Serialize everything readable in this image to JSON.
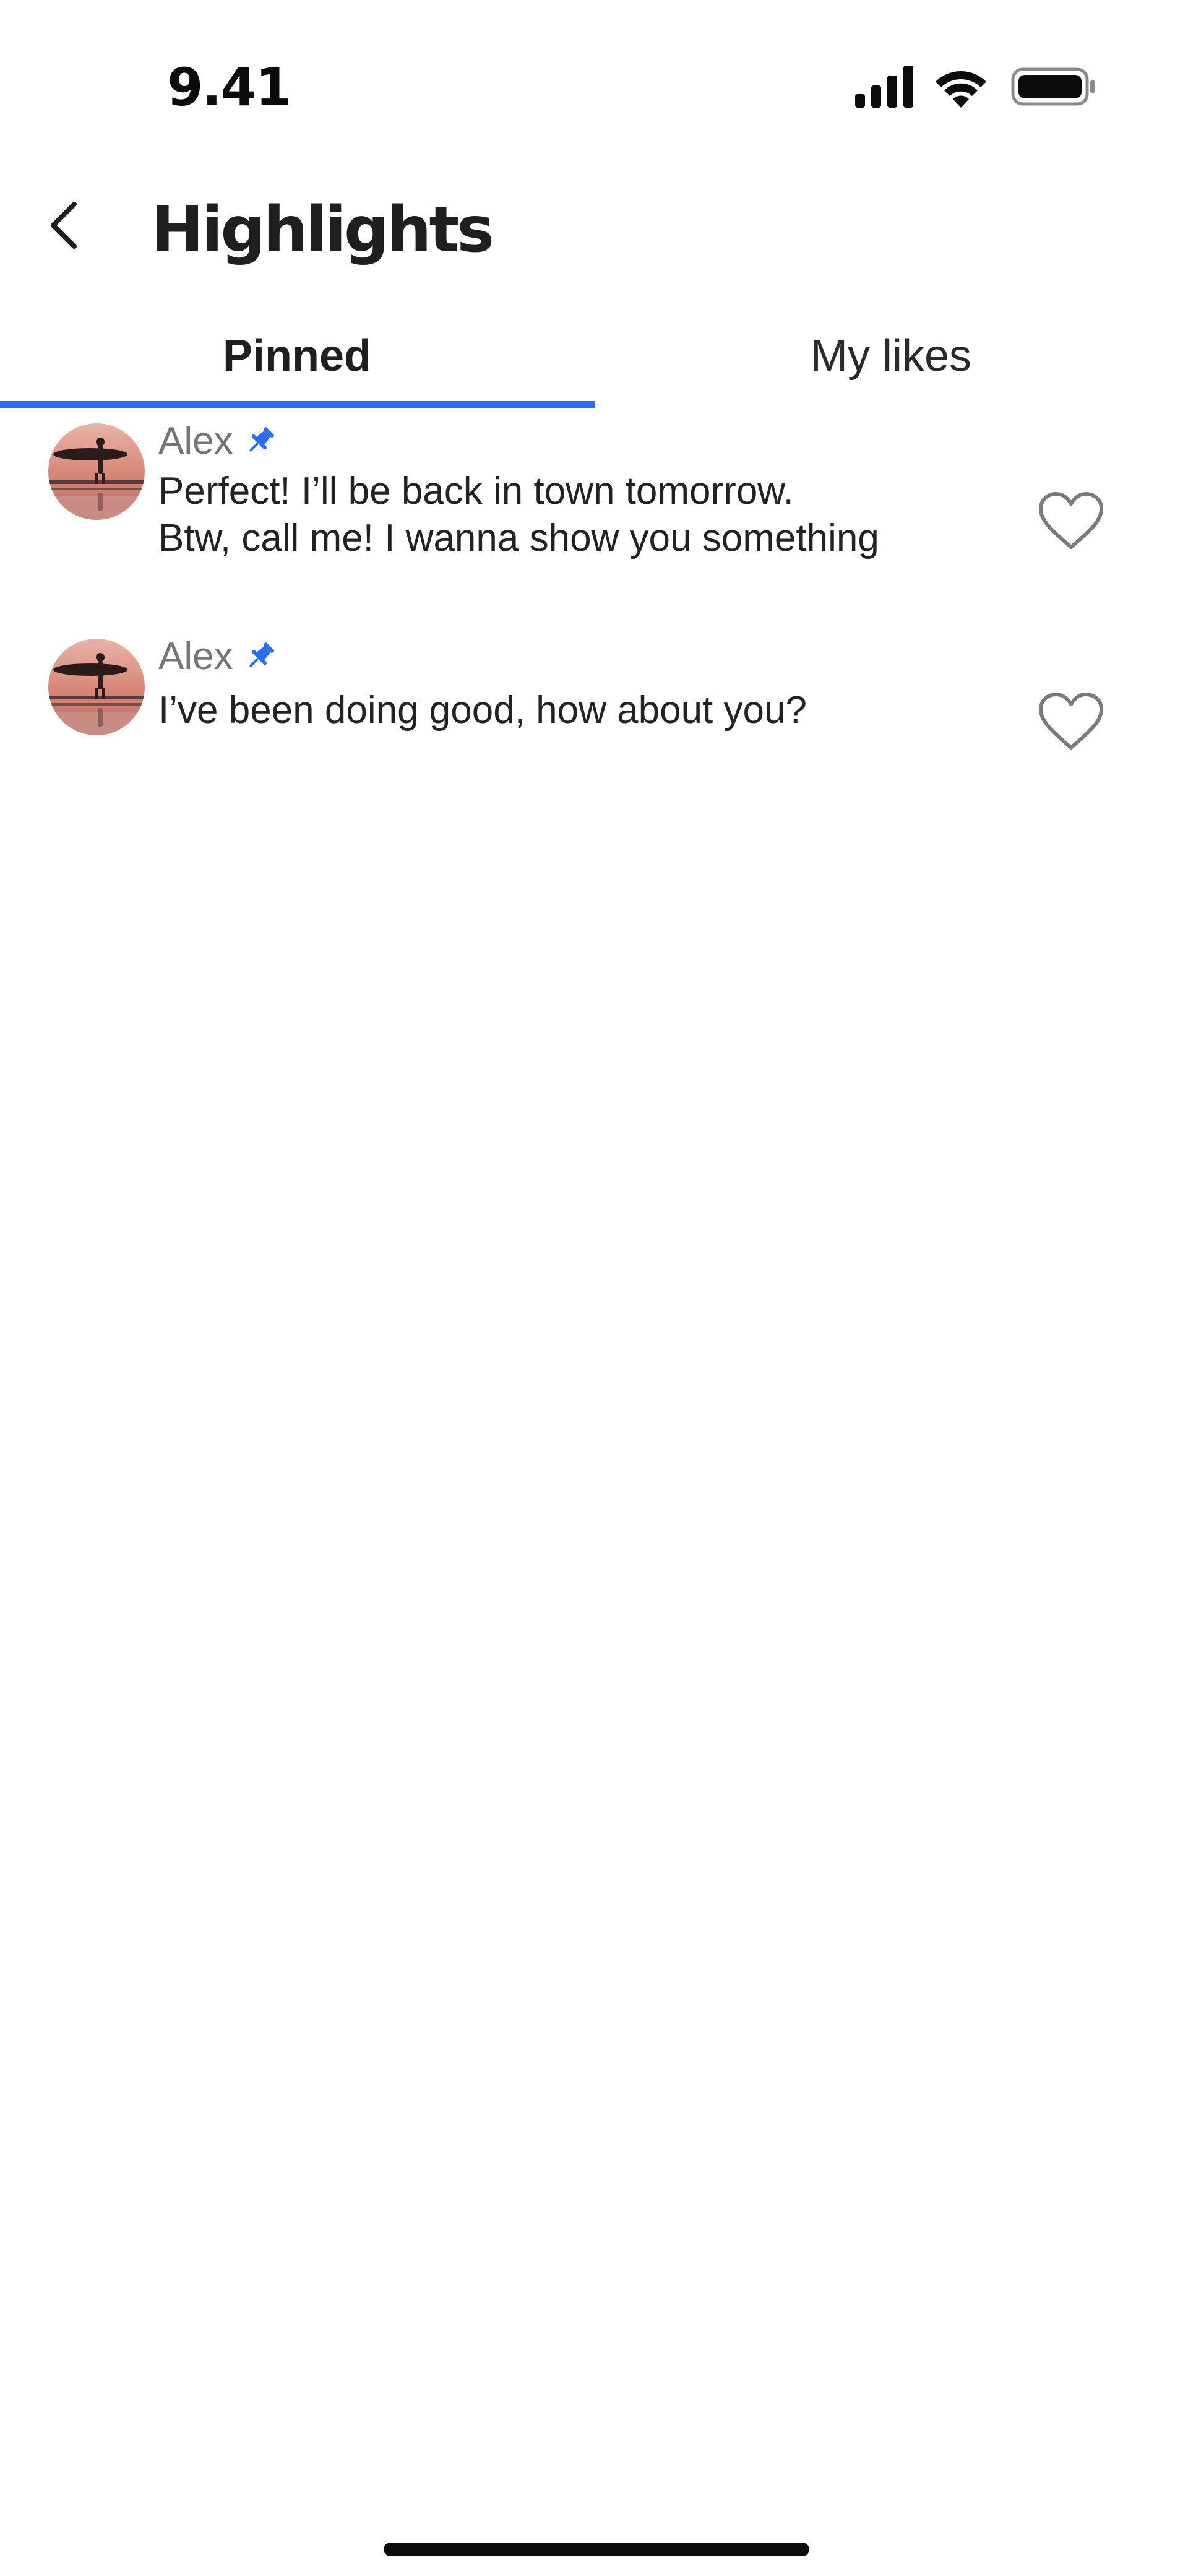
{
  "status_bar": {
    "time": "9.41",
    "icons": [
      "cellular-signal-icon",
      "wifi-icon",
      "battery-icon"
    ]
  },
  "header": {
    "title": "Highlights",
    "back_icon": "chevron-left-icon"
  },
  "tabs": [
    {
      "label": "Pinned",
      "active": true
    },
    {
      "label": "My likes",
      "active": false
    }
  ],
  "messages": [
    {
      "sender": "Alex",
      "pinned": true,
      "text": "Perfect! I’ll be back in town tomorrow.\nBtw, call me! I wanna show you something",
      "liked": false
    },
    {
      "sender": "Alex",
      "pinned": true,
      "text": "I’ve been doing good, how about you?",
      "liked": false
    }
  ],
  "colors": {
    "accent": "#2a6df0",
    "sender_text": "#757575",
    "body_text": "#222222"
  }
}
